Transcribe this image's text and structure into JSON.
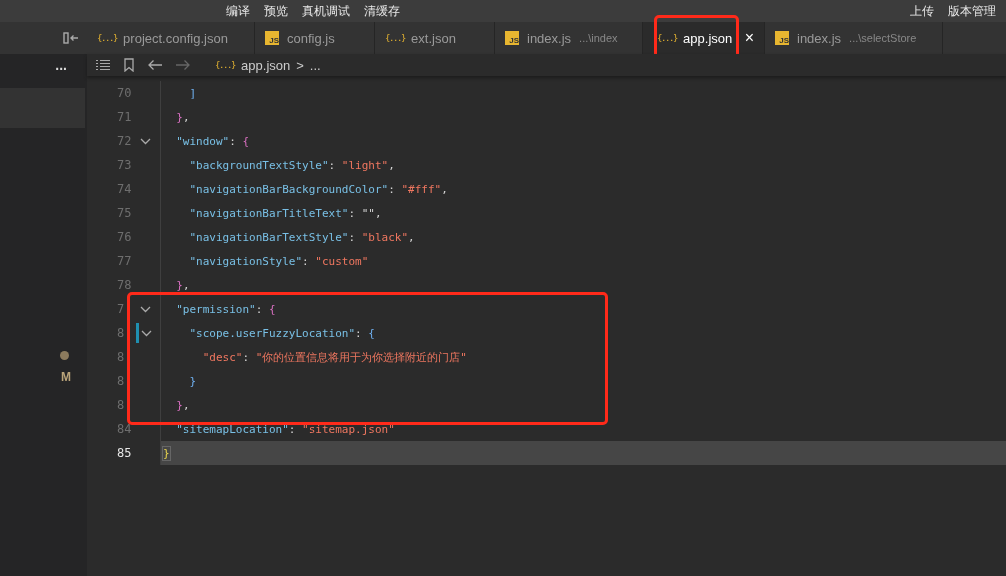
{
  "toolbar": {
    "center_items": [
      "编译",
      "预览",
      "真机调试",
      "清缓存"
    ],
    "right_items": [
      "上传",
      "版本管理"
    ]
  },
  "tabs": [
    {
      "kind": "json",
      "icon_text": "{...}",
      "label": "project.config.json",
      "selected": false
    },
    {
      "kind": "js",
      "icon_text": "JS",
      "label": "config.js",
      "selected": false
    },
    {
      "kind": "json",
      "icon_text": "{...}",
      "label": "ext.json",
      "selected": false
    },
    {
      "kind": "js",
      "icon_text": "JS",
      "label": "index.js",
      "path": "...\\index",
      "selected": false
    },
    {
      "kind": "json",
      "icon_text": "{...}",
      "label": "app.json",
      "selected": true,
      "close": "×"
    },
    {
      "kind": "js",
      "icon_text": "JS",
      "label": "index.js",
      "path": "...\\selectStore",
      "selected": false
    }
  ],
  "sidebar": {
    "more": "...",
    "badge_dot": true,
    "status": "M"
  },
  "breadcrumb": {
    "icon_text": "{...}",
    "file": "app.json",
    "separator": ">",
    "rest": "..."
  },
  "editor": {
    "lines": [
      {
        "number": "70",
        "fold": false,
        "modified": false,
        "current": false,
        "tokens": [
          {
            "kind": "b2",
            "text": "    ]"
          }
        ]
      },
      {
        "number": "71",
        "fold": false,
        "modified": false,
        "current": false,
        "tokens": [
          {
            "kind": "b1",
            "text": "  }"
          },
          {
            "kind": "punct",
            "text": ","
          }
        ]
      },
      {
        "number": "72",
        "fold": true,
        "modified": false,
        "current": false,
        "tokens": [
          {
            "kind": "key",
            "text": "  \"window\""
          },
          {
            "kind": "punct",
            "text": ": "
          },
          {
            "kind": "b1",
            "text": "{"
          }
        ]
      },
      {
        "number": "73",
        "fold": false,
        "modified": false,
        "current": false,
        "tokens": [
          {
            "kind": "key",
            "text": "    \"backgroundTextStyle\""
          },
          {
            "kind": "punct",
            "text": ": "
          },
          {
            "kind": "str",
            "text": "\"light\""
          },
          {
            "kind": "punct",
            "text": ","
          }
        ]
      },
      {
        "number": "74",
        "fold": false,
        "modified": false,
        "current": false,
        "tokens": [
          {
            "kind": "key",
            "text": "    \"navigationBarBackgroundColor\""
          },
          {
            "kind": "punct",
            "text": ": "
          },
          {
            "kind": "str",
            "text": "\"#fff\""
          },
          {
            "kind": "punct",
            "text": ","
          }
        ]
      },
      {
        "number": "75",
        "fold": false,
        "modified": false,
        "current": false,
        "tokens": [
          {
            "kind": "key",
            "text": "    \"navigationBarTitleText\""
          },
          {
            "kind": "punct",
            "text": ": \"\","
          }
        ]
      },
      {
        "number": "76",
        "fold": false,
        "modified": false,
        "current": false,
        "tokens": [
          {
            "kind": "key",
            "text": "    \"navigationBarTextStyle\""
          },
          {
            "kind": "punct",
            "text": ": "
          },
          {
            "kind": "str",
            "text": "\"black\""
          },
          {
            "kind": "punct",
            "text": ","
          }
        ]
      },
      {
        "number": "77",
        "fold": false,
        "modified": false,
        "current": false,
        "tokens": [
          {
            "kind": "key",
            "text": "    \"navigationStyle\""
          },
          {
            "kind": "punct",
            "text": ": "
          },
          {
            "kind": "str",
            "text": "\"custom\""
          }
        ]
      },
      {
        "number": "78",
        "fold": false,
        "modified": false,
        "current": false,
        "tokens": [
          {
            "kind": "b1",
            "text": "  }"
          },
          {
            "kind": "punct",
            "text": ","
          }
        ]
      },
      {
        "number": "7",
        "fold": true,
        "modified": false,
        "current": false,
        "tokens": [
          {
            "kind": "key",
            "text": "  \"permission\""
          },
          {
            "kind": "punct",
            "text": ": "
          },
          {
            "kind": "b1",
            "text": "{"
          }
        ]
      },
      {
        "number": "8",
        "fold": true,
        "modified": true,
        "current": false,
        "tokens": [
          {
            "kind": "key",
            "text": "    \"scope.userFuzzyLocation\""
          },
          {
            "kind": "punct",
            "text": ": "
          },
          {
            "kind": "b2",
            "text": "{"
          }
        ]
      },
      {
        "number": "8",
        "fold": false,
        "modified": false,
        "current": false,
        "tokens": [
          {
            "kind": "str",
            "text": "      \"desc\""
          },
          {
            "kind": "punct",
            "text": ": "
          },
          {
            "kind": "str",
            "text": "\"你的位置信息将用于为你选择附近的门店\""
          }
        ]
      },
      {
        "number": "8",
        "fold": false,
        "modified": false,
        "current": false,
        "tokens": [
          {
            "kind": "b2",
            "text": "    }"
          }
        ]
      },
      {
        "number": "8",
        "fold": false,
        "modified": false,
        "current": false,
        "tokens": [
          {
            "kind": "b1",
            "text": "  }"
          },
          {
            "kind": "punct",
            "text": ","
          }
        ]
      },
      {
        "number": "84",
        "fold": false,
        "modified": false,
        "current": false,
        "tokens": [
          {
            "kind": "key",
            "text": "  \"sitemapLocation\""
          },
          {
            "kind": "punct",
            "text": ": "
          },
          {
            "kind": "str",
            "text": "\"sitemap.json\""
          }
        ]
      },
      {
        "number": "85",
        "fold": false,
        "modified": false,
        "current": true,
        "tokens": [
          {
            "kind": "b0",
            "text": "}"
          }
        ]
      }
    ]
  }
}
